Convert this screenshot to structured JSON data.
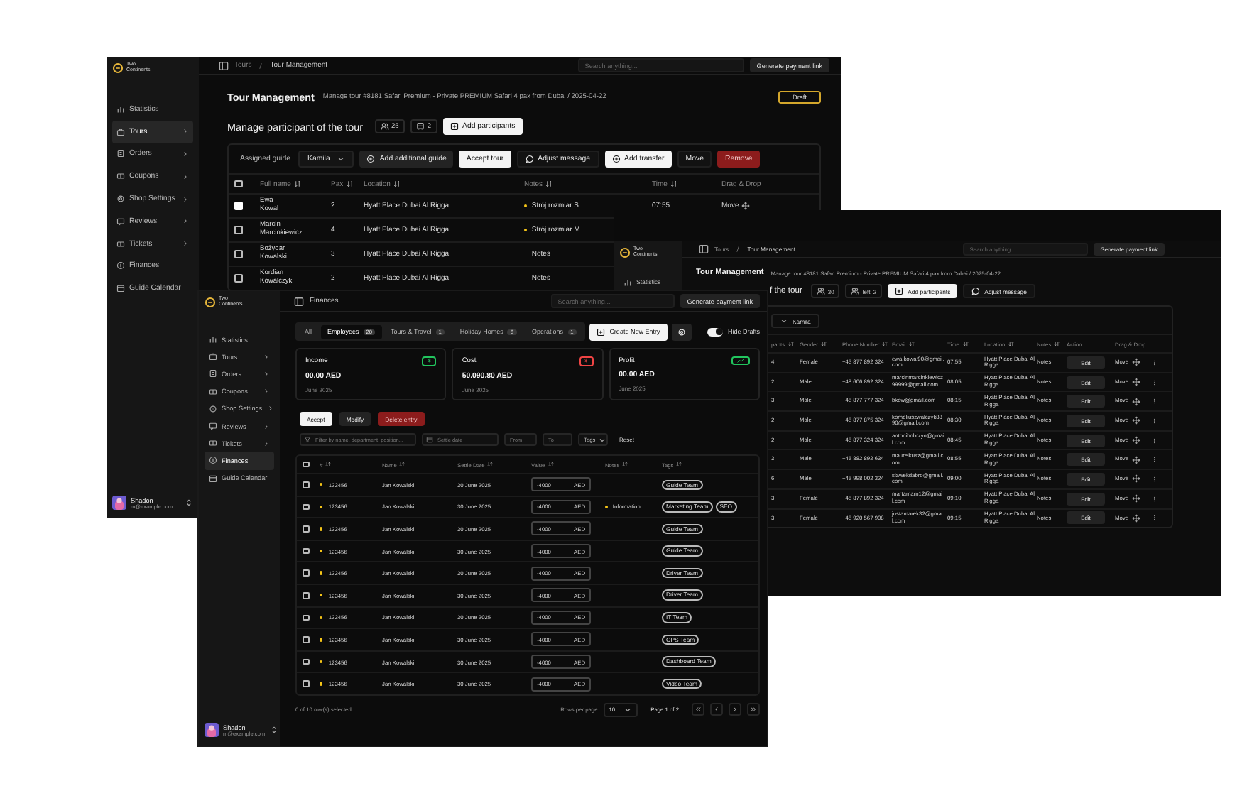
{
  "back_window": {
    "sidebar": {
      "logo": "Two Continents.",
      "items": [
        {
          "label": "Statistics",
          "selected": false,
          "expandable": false
        },
        {
          "label": "Tours",
          "selected": true,
          "expandable": true
        },
        {
          "label": "Orders",
          "selected": false,
          "expandable": true
        },
        {
          "label": "Coupons",
          "selected": false,
          "expandable": true
        },
        {
          "label": "Shop Settings",
          "selected": false,
          "expandable": true
        },
        {
          "label": "Reviews",
          "selected": false,
          "expandable": true
        },
        {
          "label": "Tickets",
          "selected": false,
          "expandable": true
        },
        {
          "label": "Finances",
          "selected": false,
          "expandable": false
        },
        {
          "label": "Guide Calendar",
          "selected": false,
          "expandable": false
        }
      ],
      "user": {
        "name": "Shadon",
        "email": "m@example.com"
      }
    },
    "header": {
      "breadcrumb": [
        "Tours",
        "Tour Management"
      ],
      "search_placeholder": "Search anything...",
      "action": "Generate payment link"
    },
    "title": "Tour Management",
    "subtitle": "Manage tour #8181 Safari Premium - Private PREMIUM Safari 4 pax from Dubai / 2025-04-22",
    "status": "Draft",
    "participants": {
      "heading": "Manage participant of the tour",
      "people": "25",
      "vehicles": "2",
      "add_button": "Add participants"
    },
    "toolbar": {
      "guide_label": "Assigned guide",
      "guide": "Kamila",
      "buttons": [
        {
          "label": "Add additional guide",
          "kind": "dark"
        },
        {
          "label": "Accept tour",
          "kind": "light"
        },
        {
          "label": "Adjust message",
          "kind": "ghost"
        },
        {
          "label": "Add transfer",
          "kind": "light"
        },
        {
          "label": "Move",
          "kind": "ghost"
        },
        {
          "label": "Remove",
          "kind": "danger"
        }
      ]
    },
    "table": {
      "all_selected": false,
      "columns": [
        "Full name",
        "Pax",
        "Location",
        "Notes",
        "Time",
        "Drag & Drop"
      ],
      "rows": [
        {
          "name": "Ewa Kowal",
          "selected": true,
          "pax": "2",
          "location": "Hyatt Place Dubai Al Rigga",
          "notes": "Strój rozmiar S",
          "flagged": true,
          "time": "07:55",
          "drag": "Move"
        },
        {
          "name": "Marcin Marcinkiewicz",
          "selected": false,
          "pax": "4",
          "location": "Hyatt Place Dubai Al Rigga",
          "notes": "Strój rozmiar M",
          "flagged": true
        },
        {
          "name": "Bożydar Kowalski",
          "selected": false,
          "pax": "3",
          "location": "Hyatt Place Dubai Al Rigga",
          "notes": "Notes",
          "flagged": false
        },
        {
          "name": "Kordian Kowalczyk",
          "selected": false,
          "pax": "2",
          "location": "Hyatt Place Dubai Al Rigga",
          "notes": "Notes",
          "flagged": false
        }
      ]
    }
  },
  "middle_window": {
    "sidebar": {
      "logo": "Two Continents.",
      "items": [
        {
          "label": "Statistics",
          "selected": false,
          "expandable": false
        }
      ]
    },
    "header": {
      "breadcrumb": [
        "Tours",
        "Tour Management"
      ],
      "search_placeholder": "Search anything...",
      "action": "Generate payment link"
    },
    "title": "Tour Management",
    "subtitle": "Manage tour #8181 Safari Premium - Private PREMIUM Safari 4 pax from Dubai / 2025-04-22",
    "participants": {
      "heading": "f the tour",
      "people": "30",
      "left": "left: 2",
      "add_button": "Add participants",
      "message_button": "Adjust message"
    },
    "guide": "Kamila",
    "table": {
      "columns": [
        "pants",
        "Gender",
        "Phone Number",
        "Email",
        "Time",
        "Location",
        "Notes",
        "Action",
        "Drag & Drop"
      ],
      "rows": [
        {
          "count": "4",
          "gender": "Female",
          "phone": "+45 877 892 324",
          "email": "ewa.kowal90@gmail.com",
          "time": "07:55",
          "location": "Hyatt Place Dubai Al Rigga",
          "notes": "Notes",
          "action": "Edit",
          "drag": "Move"
        },
        {
          "count": "2",
          "gender": "Male",
          "phone": "+48 606 892 324",
          "email": "marcinmarcinkiewicz99999@gmail.com",
          "time": "08:05",
          "location": "Hyatt Place Dubai Al Rigga",
          "notes": "Notes",
          "action": "Edit",
          "drag": "Move"
        },
        {
          "count": "3",
          "gender": "Male",
          "phone": "+45 877 777 324",
          "email": "bkow@gmail.com",
          "time": "08:15",
          "location": "Hyatt Place Dubai Al Rigga",
          "notes": "Notes",
          "action": "Edit",
          "drag": "Move"
        },
        {
          "count": "2",
          "gender": "Male",
          "phone": "+45 877 875 324",
          "email": "korneliuszwalczyk8890@gmail.com",
          "time": "08:30",
          "location": "Hyatt Place Dubai Al Rigga",
          "notes": "Notes",
          "action": "Edit",
          "drag": "Move"
        },
        {
          "count": "2",
          "gender": "Male",
          "phone": "+45 877 324 324",
          "email": "antonibobrzyn@gmail.com",
          "time": "08:45",
          "location": "Hyatt Place Dubai Al Rigga",
          "notes": "Notes",
          "action": "Edit",
          "drag": "Move"
        },
        {
          "count": "3",
          "gender": "Male",
          "phone": "+45 882 892 634",
          "email": "maurelkusz@gmail.com",
          "time": "08:55",
          "location": "Hyatt Place Dubai Al Rigga",
          "notes": "Notes",
          "action": "Edit",
          "drag": "Move"
        },
        {
          "count": "6",
          "gender": "Male",
          "phone": "+45 998 002 324",
          "email": "slawekdabro@gmail.com",
          "time": "09:00",
          "location": "Hyatt Place Dubai Al Rigga",
          "notes": "Notes",
          "action": "Edit",
          "drag": "Move"
        },
        {
          "count": "3",
          "gender": "Female",
          "phone": "+45 877 892 324",
          "email": "martamarn12@gmail.com",
          "time": "09:10",
          "location": "Hyatt Place Dubai Al Rigga",
          "notes": "Notes",
          "action": "Edit",
          "drag": "Move"
        },
        {
          "count": "3",
          "gender": "Female",
          "phone": "+45 920 567 908",
          "email": "justamarek32@gmail.com",
          "time": "09:15",
          "location": "Hyatt Place Dubai Al Rigga",
          "notes": "Notes",
          "action": "Edit",
          "drag": "Move"
        }
      ]
    }
  },
  "front_window": {
    "sidebar": {
      "logo": "Two Continents.",
      "items": [
        {
          "label": "Statistics",
          "selected": false,
          "expandable": false
        },
        {
          "label": "Tours",
          "selected": false,
          "expandable": true
        },
        {
          "label": "Orders",
          "selected": false,
          "expandable": true
        },
        {
          "label": "Coupons",
          "selected": false,
          "expandable": true
        },
        {
          "label": "Shop Settings",
          "selected": false,
          "expandable": true
        },
        {
          "label": "Reviews",
          "selected": false,
          "expandable": true
        },
        {
          "label": "Tickets",
          "selected": false,
          "expandable": true
        },
        {
          "label": "Finances",
          "selected": true,
          "expandable": false
        },
        {
          "label": "Guide Calendar",
          "selected": false,
          "expandable": false
        }
      ],
      "user": {
        "name": "Shadon",
        "email": "m@example.com"
      }
    },
    "header": {
      "breadcrumb": [
        "Finances"
      ],
      "search_placeholder": "Search anything...",
      "action": "Generate payment link"
    },
    "tabs": [
      {
        "label": "All",
        "selected": false
      },
      {
        "label": "Employees",
        "count": "20",
        "selected": true
      },
      {
        "label": "Tours & Travel",
        "count": "1",
        "selected": false
      },
      {
        "label": "Holiday Homes",
        "count": "6",
        "selected": false
      },
      {
        "label": "Operations",
        "count": "1",
        "selected": false
      }
    ],
    "create_button": "Create New Entry",
    "hide_drafts": {
      "label": "Hide Drafts",
      "on": true
    },
    "cards": [
      {
        "title": "Income",
        "kind": "currency",
        "badge": "$",
        "color": "#22c55e",
        "amount": "00.00 AED",
        "period": "June 2025"
      },
      {
        "title": "Cost",
        "kind": "currency",
        "badge": "$",
        "color": "#ef4444",
        "amount": "50.090.80 AED",
        "period": "June 2025"
      },
      {
        "title": "Profit",
        "kind": "trend",
        "color": "#22c55e",
        "amount": "00.00 AED",
        "period": "June 2025"
      }
    ],
    "actions": [
      {
        "label": "Accept",
        "kind": "light"
      },
      {
        "label": "Modify",
        "kind": "dark"
      },
      {
        "label": "Delete entry",
        "kind": "danger"
      }
    ],
    "filters": {
      "search_placeholder": "Filter by name, department, position...",
      "date_placeholder": "Settle date",
      "from_placeholder": "From",
      "to_placeholder": "To",
      "tags": "Tags",
      "reset": "Reset"
    },
    "table": {
      "all_selected": false,
      "columns": [
        "#",
        "Name",
        "Settle Date",
        "Value",
        "Notes",
        "Tags"
      ],
      "rows": [
        {
          "selected": false,
          "id": "123456",
          "name": "Jan Kowalski",
          "date": "30 June 2025",
          "value": "-4000",
          "currency": "AED",
          "tags": [
            "Guide Team"
          ]
        },
        {
          "selected": false,
          "id": "123456",
          "name": "Jan Kowalski",
          "date": "30 June 2025",
          "value": "-4000",
          "currency": "AED",
          "notes": "Information",
          "tags": [
            "Marketing Team",
            "SEO"
          ]
        },
        {
          "selected": false,
          "id": "123456",
          "name": "Jan Kowalski",
          "date": "30 June 2025",
          "value": "-4000",
          "currency": "AED",
          "tags": [
            "Guide Team"
          ]
        },
        {
          "selected": false,
          "id": "123456",
          "name": "Jan Kowalski",
          "date": "30 June 2025",
          "value": "-4000",
          "currency": "AED",
          "tags": [
            "Guide Team"
          ]
        },
        {
          "selected": false,
          "id": "123456",
          "name": "Jan Kowalski",
          "date": "30 June 2025",
          "value": "-4000",
          "currency": "AED",
          "tags": [
            "Driver Team"
          ]
        },
        {
          "selected": false,
          "id": "123456",
          "name": "Jan Kowalski",
          "date": "30 June 2025",
          "value": "-4000",
          "currency": "AED",
          "tags": [
            "Driver Team"
          ]
        },
        {
          "selected": false,
          "id": "123456",
          "name": "Jan Kowalski",
          "date": "30 June 2025",
          "value": "-4000",
          "currency": "AED",
          "tags": [
            "IT Team"
          ]
        },
        {
          "selected": false,
          "id": "123456",
          "name": "Jan Kowalski",
          "date": "30 June 2025",
          "value": "-4000",
          "currency": "AED",
          "tags": [
            "OPS Team"
          ]
        },
        {
          "selected": false,
          "id": "123456",
          "name": "Jan Kowalski",
          "date": "30 June 2025",
          "value": "-4000",
          "currency": "AED",
          "tags": [
            "Dashboard Team"
          ]
        },
        {
          "selected": false,
          "id": "123456",
          "name": "Jan Kowalski",
          "date": "30 June 2025",
          "value": "-4000",
          "currency": "AED",
          "tags": [
            "Video Team"
          ]
        }
      ]
    },
    "footer": {
      "selection": "0 of 10 row(s) selected.",
      "rows_label": "Rows per page",
      "rows_value": "10",
      "page": "Page 1 of 2"
    }
  }
}
